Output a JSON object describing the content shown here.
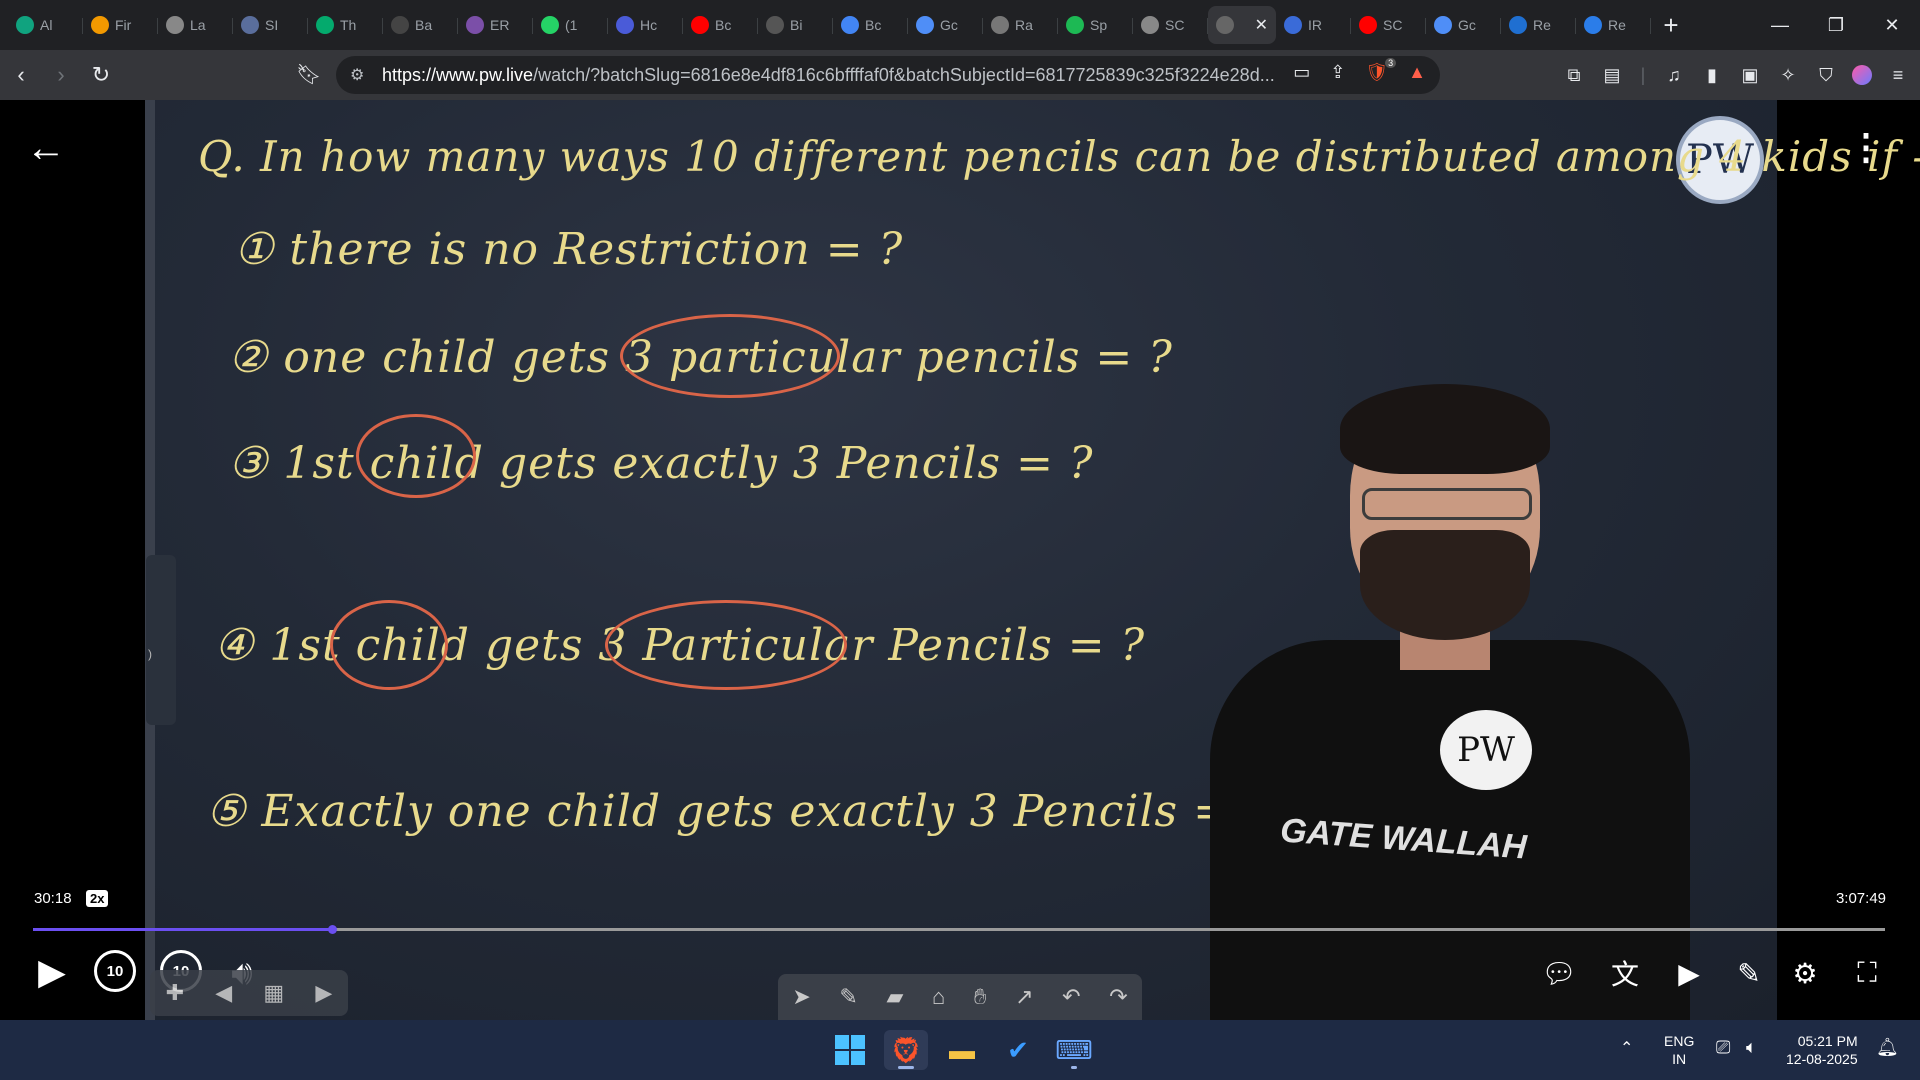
{
  "browser": {
    "tabs": [
      {
        "label": "Al",
        "icon": "chatgpt-icon",
        "color": "#10a37f"
      },
      {
        "label": "Fir",
        "icon": "fire-icon",
        "color": "#f29900"
      },
      {
        "label": "La",
        "icon": "globe-icon",
        "color": "#888888"
      },
      {
        "label": "SI",
        "icon": "grid-icon",
        "color": "#5a6e9c"
      },
      {
        "label": "Th",
        "icon": "w3schools-icon",
        "color": "#04aa6d"
      },
      {
        "label": "Ba",
        "icon": "dashboard-icon",
        "color": "#444444"
      },
      {
        "label": "ER",
        "icon": "brain-icon",
        "color": "#7b4fa8"
      },
      {
        "label": "(1",
        "icon": "whatsapp-icon",
        "color": "#25d366"
      },
      {
        "label": "Hc",
        "icon": "bookmark-icon",
        "color": "#4a5bd8"
      },
      {
        "label": "Bc",
        "icon": "youtube-icon",
        "color": "#ff0000"
      },
      {
        "label": "Bi",
        "icon": "bit-icon",
        "color": "#555555"
      },
      {
        "label": "Bc",
        "icon": "google-icon",
        "color": "#4285f4"
      },
      {
        "label": "Gc",
        "icon": "gemini-icon",
        "color": "#4f8ef7"
      },
      {
        "label": "Ra",
        "icon": "openai-icon",
        "color": "#777777"
      },
      {
        "label": "Sp",
        "icon": "spotify-icon",
        "color": "#1db954"
      },
      {
        "label": "SC",
        "icon": "globe-icon",
        "color": "#888888"
      },
      {
        "label": "",
        "icon": "pw-icon",
        "color": "#666666",
        "active": true
      },
      {
        "label": "IR",
        "icon": "image-icon",
        "color": "#3a6bd8"
      },
      {
        "label": "SC",
        "icon": "youtube-icon",
        "color": "#ff0000"
      },
      {
        "label": "Gc",
        "icon": "gemini-icon",
        "color": "#4f8ef7"
      },
      {
        "label": "Re",
        "icon": "keyboard-icon",
        "color": "#1f6fd1"
      },
      {
        "label": "Re",
        "icon": "robot-icon",
        "color": "#2b7de9"
      }
    ],
    "new_tab": "+",
    "url_host": "https://www.pw.live",
    "url_rest": "/watch/?batchSlug=6816e8e4df816c6bffffaf0f&batchSubjectId=6817725839c325f3224e28d...",
    "brave_badge": "3"
  },
  "video": {
    "board_lines": [
      {
        "text": "Q. In how many ways 10 different pencils can be distributed among 4 kids if -"
      },
      {
        "text": "① there is no Restriction = ?"
      },
      {
        "text": "② one child gets 3 particular pencils = ?"
      },
      {
        "text": "③ 1st child gets exactly 3 Pencils = ?"
      },
      {
        "text": "④ 1st child gets 3 Particular Pencils = ?"
      },
      {
        "text": "⑤ Exactly one child gets exactly 3 Pencils = ?"
      }
    ],
    "logo_text": "PW",
    "shirt_logo": "PW",
    "shirt_text": "GATE WALLAH",
    "current_time": "30:18",
    "speed": "2x",
    "duration": "3:07:49",
    "progress_fraction": 0.1614,
    "skip_back": "10",
    "skip_forward": "10",
    "side_tab_glyph": ")"
  },
  "taskbar": {
    "lang_top": "ENG",
    "lang_bottom": "IN",
    "time": "05:21 PM",
    "date": "12-08-2025"
  }
}
